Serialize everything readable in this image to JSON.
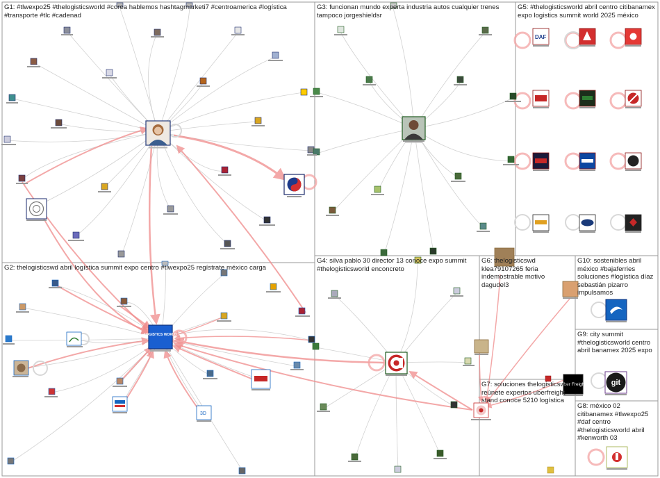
{
  "groups": [
    {
      "id": "g1",
      "label": "G1: #tlwexpo25 #thelogisticsworld #corea hablemos hashtagmarketi7 #centroamerica #logística #transporte #tlc #cadenad"
    },
    {
      "id": "g3",
      "label": "G3: funcionan mundo experta industria autos cualquier trenes tampoco jorgeshieldsr"
    },
    {
      "id": "g5",
      "label": "G5: #thelogisticsworld abril centro citibanamex expo logistics summit world 2025 méxico"
    },
    {
      "id": "g2",
      "label": "G2: thelogisticswd abril logística summit expo centro #tlwexpo25 regístrate méxico carga"
    },
    {
      "id": "g4",
      "label": "G4: silva pablo 30 director 13 conoce expo summit #thelogisticsworld enconcreto"
    },
    {
      "id": "g6",
      "label": "G6: thelogisticswd klea79107265 feria indemostrable motivo dagudel3"
    },
    {
      "id": "g10",
      "label": "G10: sostenibles abril méxico #bajaferries soluciones #logística díaz sebastián pizarro impulsamos"
    },
    {
      "id": "g9",
      "label": "G9: city summit #thelogisticsworld centro abril banamex 2025 expo"
    },
    {
      "id": "g7",
      "label": "G7: soluciones thelogisticswd reúnete expertos uberfreight stand conoce 5210 logística"
    },
    {
      "id": "g8",
      "label": "G8: méxico 02 citibanamex #tlwexpo25 #daf centro #thelogisticsworld abril #kenworth 03"
    }
  ],
  "icon_texts": {
    "logistics_world": "LOGISTICS WORLD",
    "uber_freight": "Uber Freight",
    "git": "git"
  },
  "colors": {
    "edge_gray": "#c9c9c9",
    "edge_red": "#f08b8b",
    "box_border": "#9a9a9a",
    "logo_blue": "#1565c0",
    "logo_red": "#d32f2f"
  }
}
